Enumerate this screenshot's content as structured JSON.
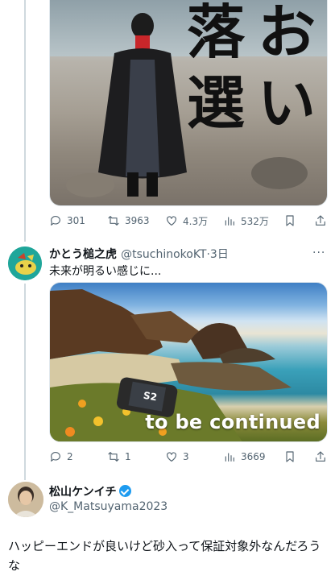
{
  "tweet1": {
    "media_text": {
      "line1_a": "落",
      "line1_b": "お",
      "line2_a": "選",
      "line2_b": "い"
    },
    "actions": {
      "replies": "301",
      "retweets": "3963",
      "likes": "4.3万",
      "views": "532万"
    }
  },
  "tweet2": {
    "display_name": "かとう槌之虎",
    "handle": "@tsuchinokoKT",
    "time": "·3日",
    "text": "未来が明るい感じに...",
    "media_overlay": "to be continued",
    "console_label": "S2",
    "actions": {
      "replies": "2",
      "retweets": "1",
      "likes": "3",
      "views": "3669"
    }
  },
  "tweet3": {
    "display_name": "松山ケンイチ",
    "handle": "@K_Matsuyama2023",
    "text": "ハッピーエンドが良いけど砂入って保証対象外なんだろうな"
  },
  "colors": {
    "accent": "#1d9bf0",
    "muted": "#536471",
    "divider": "#eff3f4"
  },
  "icons": [
    "reply-icon",
    "retweet-icon",
    "like-icon",
    "views-icon",
    "bookmark-icon",
    "share-icon",
    "more-icon",
    "verified-icon"
  ]
}
